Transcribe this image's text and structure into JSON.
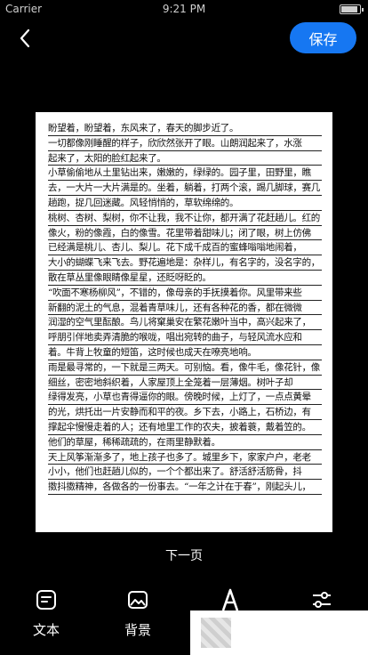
{
  "status_bar": {
    "carrier": "Carrier",
    "time": "9:21 PM"
  },
  "header": {
    "save_label": "保存"
  },
  "paper": {
    "lines": [
      "盼望着，盼望着，东风来了，春天的脚步近了。",
      "一切都像刚睡醒的样子，欣欣然张开了眼。山朗润起来了，水涨",
      "起来了，太阳的脸红起来了。",
      "小草偷偷地从土里钻出来，嫩嫩的，绿绿的。园子里，田野里，瞧",
      "去，一大片一大片满是的。坐着，躺着，打两个滚，踢几脚球，赛几",
      "趟跑，捉几回迷藏。风轻悄悄的，草软绵绵的。",
      "桃树、杏树、梨树，你不让我，我不让你，都开满了花赶趟儿。红的",
      "像火，粉的像霞，白的像雪。花里带着甜味儿；闭了眼，树上仿佛",
      "已经满是桃儿、杏儿、梨儿。花下成千成百的蜜蜂嗡嗡地闹着，",
      "大小的蝴蝶飞来飞去。野花遍地是：杂样儿，有名字的，没名字的，",
      "散在草丛里像眼睛像星星，还眨呀眨的。",
      "“吹面不寒杨柳风”，不错的，像母亲的手抚摸着你。风里带来些",
      "新翻的泥土的气息，混着青草味儿，还有各种花的香，都在微微",
      "润湿的空气里酝酿。鸟儿将窠巢安在繁花嫩叶当中，高兴起来了，",
      "呼朋引伴地卖弄清脆的喉咙，唱出宛转的曲子，与轻风流水应和",
      "着。牛背上牧童的短笛，这时候也成天在嘹亮地响。",
      "雨是最寻常的，一下就是三两天。可别恼。看，像牛毛，像花针，像",
      "细丝，密密地斜织着，人家屋顶上全笼着一层薄烟。树叶子却",
      "绿得发亮，小草也青得逼你的眼。傍晚时候，上灯了，一点点黄晕",
      "的光，烘托出一片安静而和平的夜。乡下去，小路上，石桥边，有",
      "撑起伞慢慢走着的人；还有地里工作的农夫，披着蓑，戴着笠的。",
      "他们的草屋，稀稀疏疏的，在雨里静默着。",
      "天上风筝渐渐多了，地上孩子也多了。城里乡下，家家户户，老老",
      "小小，他们也赶趟儿似的，一个个都出来了。舒活舒活筋骨，抖",
      "擞抖擞精神，各做各的一份事去。“一年之计在于春”，刚起头儿，"
    ]
  },
  "next_page_label": "下一页",
  "toolbar": {
    "text_label": "文本",
    "background_label": "背景"
  },
  "colors": {
    "accent": "#1677f2",
    "background": "#000000",
    "paper": "#ffffff"
  }
}
